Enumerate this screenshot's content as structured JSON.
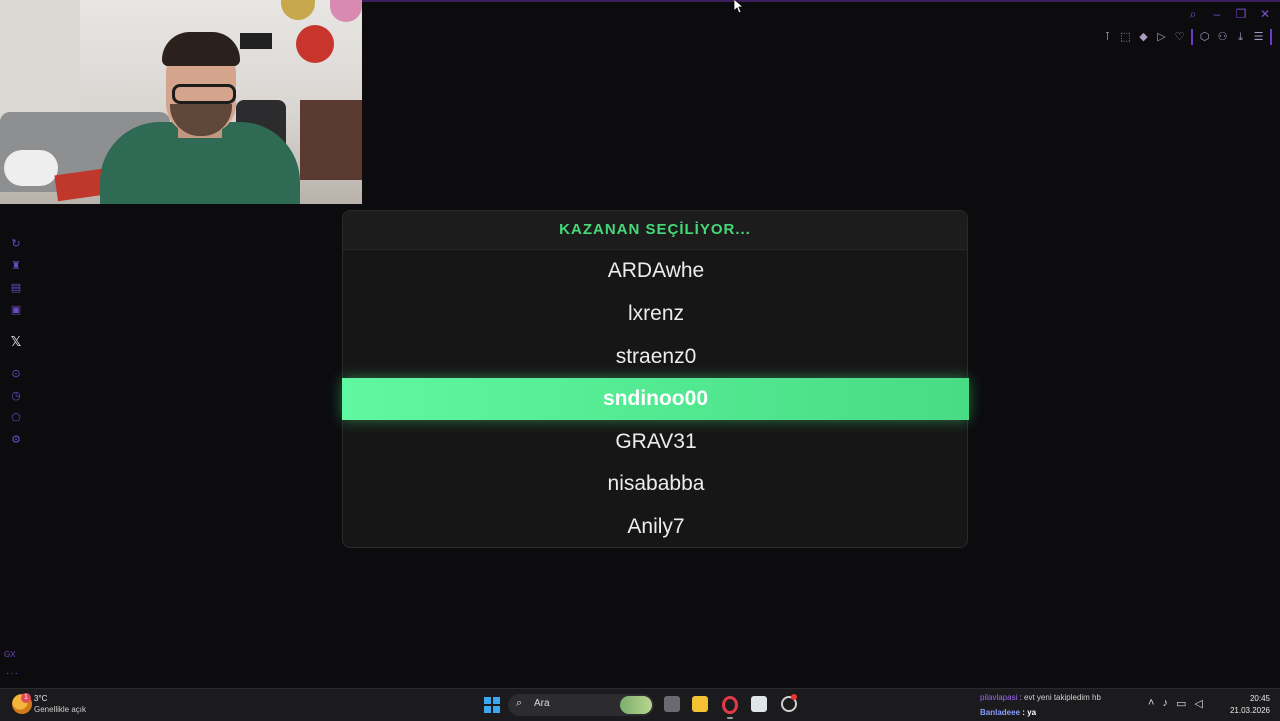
{
  "panel": {
    "title": "KAZANAN SEÇİLİYOR...",
    "names": [
      "ARDAwhe",
      "lxrenz",
      "straenz0",
      "sndinoo00",
      "GRAV31",
      "nisababba",
      "Anily7"
    ],
    "selected_name": "sndinoo00"
  },
  "sidebar": {
    "icons": [
      "refresh-icon",
      "bot-icon",
      "stats-icon",
      "media-icon",
      "x-logo-icon",
      "play-circle-icon",
      "history-icon",
      "extension-icon",
      "settings-icon"
    ],
    "x_glyph": "𝕏",
    "gx_label": "GX",
    "more_label": "···"
  },
  "taskbar": {
    "weather_temp": "3°C",
    "weather_desc": "Genellikle açık",
    "weather_badge": "1",
    "search_placeholder": "Ara",
    "chat_line1_user": "pilavlapasi",
    "chat_line1_text": " : evt yeni takipledim hb",
    "chat_line2_user": "Banladeee",
    "chat_line2_text": " : ya",
    "time": "20:45",
    "date": "21.03.2026"
  },
  "colors": {
    "accent_green": "#46d978",
    "selected_row": "#5ff7a0",
    "browser_accent": "#6a3bc8"
  }
}
